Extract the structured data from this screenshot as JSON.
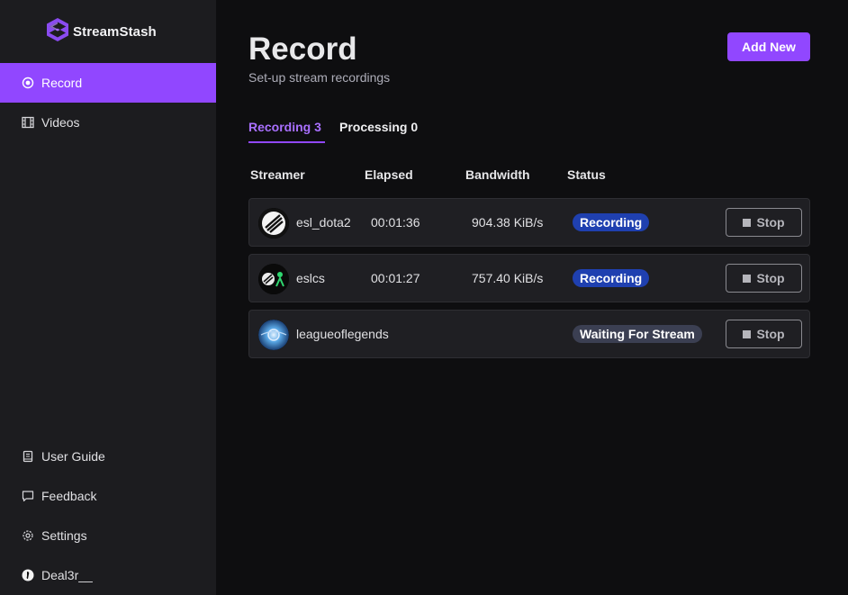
{
  "app": {
    "name": "StreamStash"
  },
  "sidebar": {
    "items": [
      {
        "label": "Record",
        "icon": "record-icon"
      },
      {
        "label": "Videos",
        "icon": "film-icon"
      }
    ],
    "bottom_items": [
      {
        "label": "User Guide",
        "icon": "book-icon"
      },
      {
        "label": "Feedback",
        "icon": "message-icon"
      },
      {
        "label": "Settings",
        "icon": "gear-icon"
      },
      {
        "label": "Deal3r__",
        "icon": "user-avatar"
      }
    ]
  },
  "header": {
    "title": "Record",
    "subtitle": "Set-up stream recordings",
    "add_button": "Add New"
  },
  "tabs": [
    {
      "label": "Recording 3"
    },
    {
      "label": "Processing 0"
    }
  ],
  "table": {
    "columns": [
      "Streamer",
      "Elapsed",
      "Bandwidth",
      "Status"
    ],
    "rows": [
      {
        "streamer": "esl_dota2",
        "elapsed": "00:01:36",
        "bandwidth": "904.38 KiB/s",
        "status": "Recording",
        "action": "Stop"
      },
      {
        "streamer": "eslcs",
        "elapsed": "00:01:27",
        "bandwidth": "757.40 KiB/s",
        "status": "Recording",
        "action": "Stop"
      },
      {
        "streamer": "leagueoflegends",
        "elapsed": "",
        "bandwidth": "",
        "status": "Waiting For Stream",
        "action": "Stop"
      }
    ]
  },
  "colors": {
    "accent": "#9147ff",
    "recording_badge": "#1f40b0",
    "waiting_badge": "#3b3f52",
    "sidebar_bg": "#1c1c1f",
    "main_bg": "#0e0e10"
  }
}
